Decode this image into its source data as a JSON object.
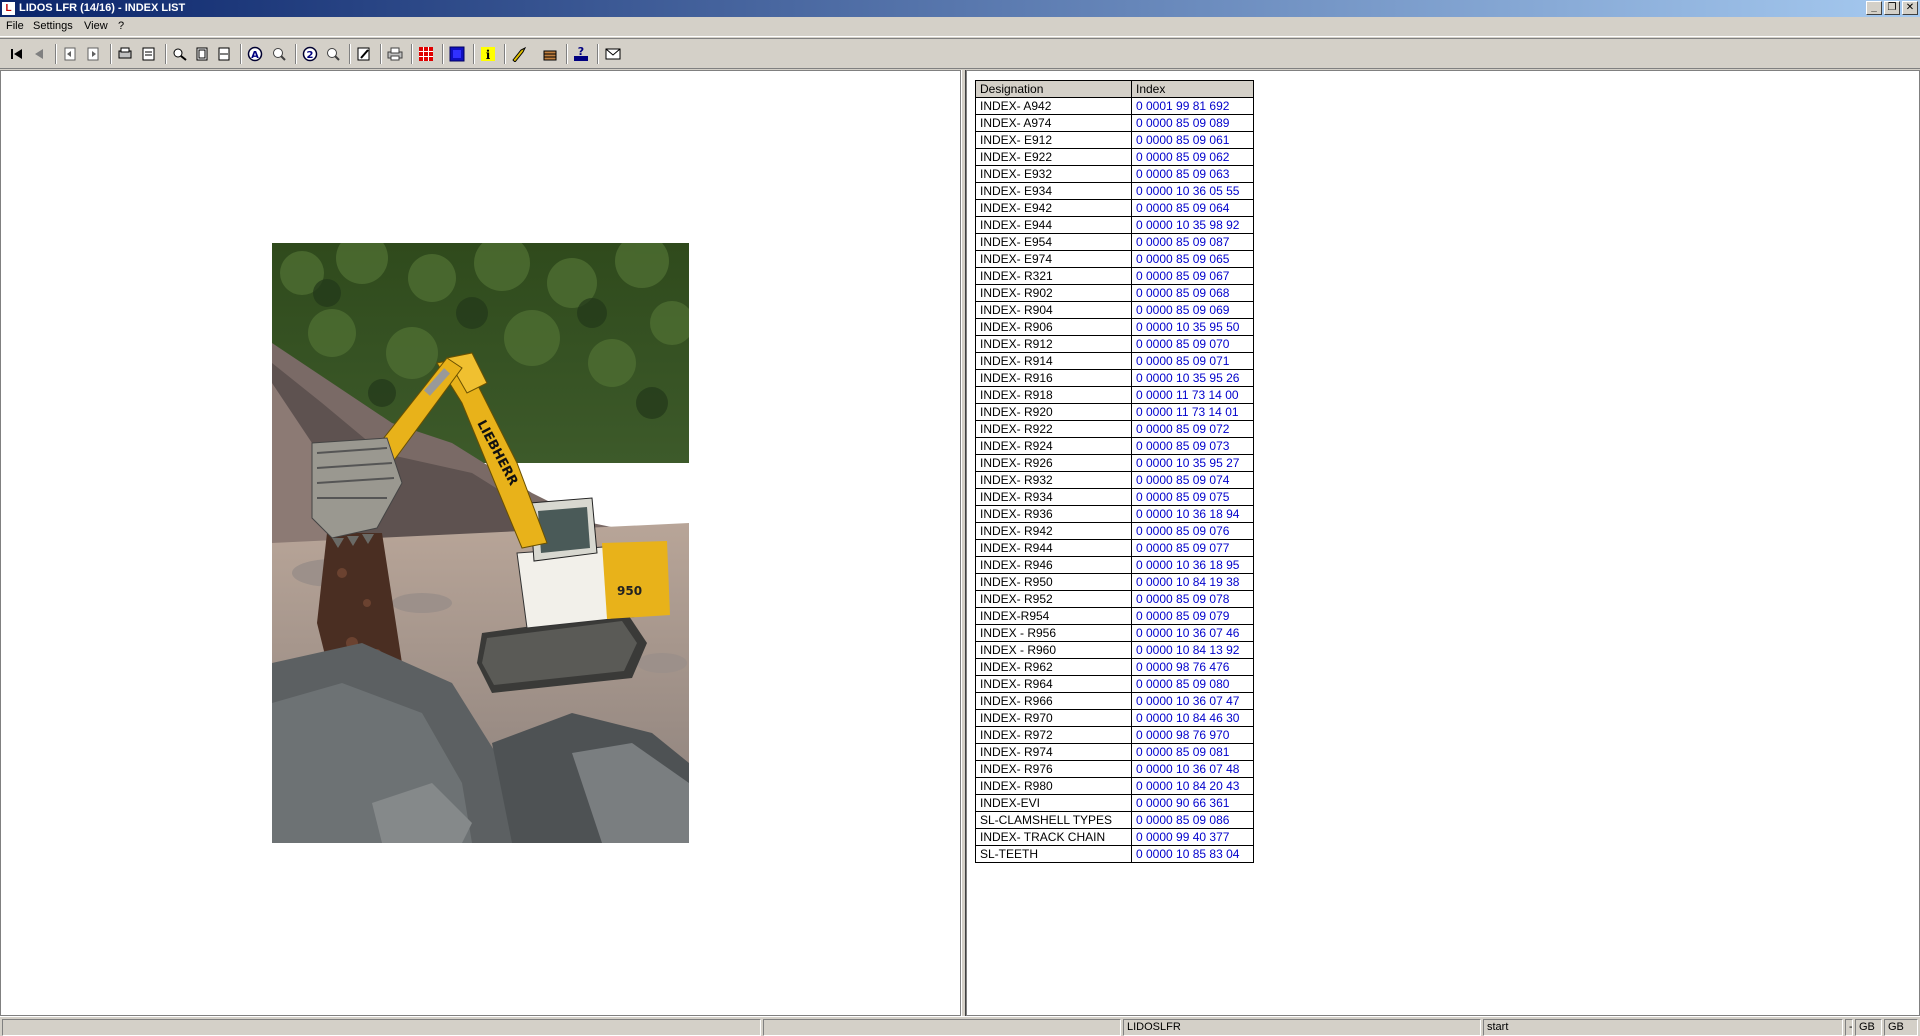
{
  "window": {
    "title": "LIDOS LFR (14/16) - INDEX LIST",
    "app_icon_text": "L",
    "minimize_glyph": "_",
    "restore_glyph": "❐",
    "close_glyph": "✕"
  },
  "menu": [
    "File",
    "Settings",
    "View",
    "?"
  ],
  "toolbar": {
    "icons": [
      "first-icon",
      "back-icon",
      "page-prev-icon",
      "page-next-icon",
      "print-preview-icon",
      "document-icon",
      "zoom-in-icon",
      "fit-page-icon",
      "fit-width-icon",
      "annotation-a-icon",
      "annotation-search-icon",
      "zoom-2-icon",
      "search-replace-icon",
      "edit-icon",
      "print-icon",
      "grid-icon",
      "blue-square-icon",
      "info-icon",
      "tools-icon",
      "basket-icon",
      "help-lidos-icon",
      "mail-icon"
    ]
  },
  "image": {
    "name": "excavator-photo",
    "brand_text": "LIEBHERR",
    "model_text": "950"
  },
  "table": {
    "headers": [
      "Designation",
      "Index"
    ],
    "rows": [
      [
        "INDEX- A942",
        "0 0001 99 81 692"
      ],
      [
        "INDEX- A974",
        "0 0000 85 09 089"
      ],
      [
        "INDEX- E912",
        "0 0000 85 09 061"
      ],
      [
        "INDEX- E922",
        "0 0000 85 09 062"
      ],
      [
        "INDEX- E932",
        "0 0000 85 09 063"
      ],
      [
        "INDEX- E934",
        "0 0000 10 36 05 55"
      ],
      [
        "INDEX- E942",
        "0 0000 85 09 064"
      ],
      [
        "INDEX- E944",
        "0 0000 10 35 98 92"
      ],
      [
        "INDEX- E954",
        "0 0000 85 09 087"
      ],
      [
        "INDEX- E974",
        "0 0000 85 09 065"
      ],
      [
        "INDEX- R321",
        "0 0000 85 09 067"
      ],
      [
        "INDEX- R902",
        "0 0000 85 09 068"
      ],
      [
        "INDEX- R904",
        "0 0000 85 09 069"
      ],
      [
        "INDEX- R906",
        "0 0000 10 35 95 50"
      ],
      [
        "INDEX- R912",
        "0 0000 85 09 070"
      ],
      [
        "INDEX- R914",
        "0 0000 85 09 071"
      ],
      [
        "INDEX- R916",
        "0 0000 10 35 95 26"
      ],
      [
        "INDEX- R918",
        "0 0000 11 73 14 00"
      ],
      [
        "INDEX- R920",
        "0 0000 11 73 14 01"
      ],
      [
        "INDEX- R922",
        "0 0000 85 09 072"
      ],
      [
        "INDEX- R924",
        "0 0000 85 09 073"
      ],
      [
        "INDEX- R926",
        "0 0000 10 35 95 27"
      ],
      [
        "INDEX- R932",
        "0 0000 85 09 074"
      ],
      [
        "INDEX- R934",
        "0 0000 85 09 075"
      ],
      [
        "INDEX- R936",
        "0 0000 10 36 18 94"
      ],
      [
        "INDEX- R942",
        "0 0000 85 09 076"
      ],
      [
        "INDEX- R944",
        "0 0000 85 09 077"
      ],
      [
        "INDEX- R946",
        "0 0000 10 36 18 95"
      ],
      [
        "INDEX- R950",
        "0 0000 10 84 19 38"
      ],
      [
        "INDEX- R952",
        "0 0000 85 09 078"
      ],
      [
        "INDEX-R954",
        "0 0000 85 09 079"
      ],
      [
        "INDEX - R956",
        "0 0000 10 36 07 46"
      ],
      [
        "INDEX - R960",
        "0 0000 10 84 13 92"
      ],
      [
        "INDEX- R962",
        "0 0000 98 76 476"
      ],
      [
        "INDEX- R964",
        "0 0000 85 09 080"
      ],
      [
        "INDEX- R966",
        "0 0000 10 36 07 47"
      ],
      [
        "INDEX- R970",
        "0 0000 10 84 46 30"
      ],
      [
        "INDEX- R972",
        "0 0000 98 76 970"
      ],
      [
        "INDEX- R974",
        "0 0000 85 09 081"
      ],
      [
        "INDEX- R976",
        "0 0000 10 36 07 48"
      ],
      [
        "INDEX- R980",
        "0 0000 10 84 20 43"
      ],
      [
        "INDEX-EVI",
        "0 0000 90 66 361"
      ],
      [
        "SL-CLAMSHELL TYPES",
        "0 0000 85 09 086"
      ],
      [
        "INDEX- TRACK CHAIN",
        "0 0000 99 40 377"
      ],
      [
        "SL-TEETH",
        "0 0000 10 85 83 04"
      ]
    ]
  },
  "status": {
    "panel1": "",
    "panel2": "",
    "app": "LIDOSLFR",
    "state": "start",
    "grip": "-",
    "lang1": "GB",
    "lang2": "GB"
  },
  "colors": {
    "link": "#0000cc",
    "titlebar_start": "#0a246a",
    "titlebar_end": "#a6caf0",
    "face": "#d4d0c8"
  }
}
